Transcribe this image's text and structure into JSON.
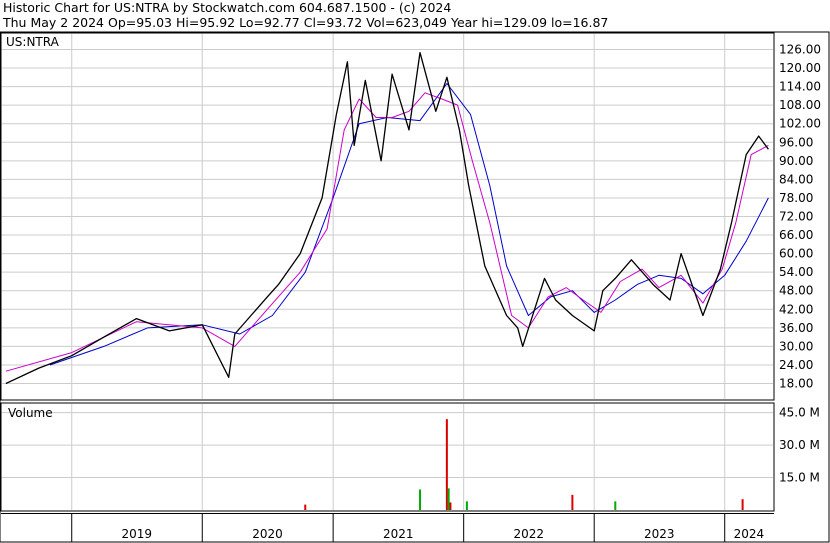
{
  "header": {
    "line1": "Historic Chart for US:NTRA by Stockwatch.com 604.687.1500 - (c) 2024",
    "line2": "Thu May  2 2024   Op=95.03   Hi=95.92   Lo=92.77   Cl=93.72   Vol=623,049   Year hi=129.09   lo=16.87"
  },
  "colors": {
    "price": "#000000",
    "ma_short": "#cc00cc",
    "ma_long": "#0000cc",
    "volume_down": "#dd0000",
    "volume_up": "#00aa00",
    "grid": "#cccccc"
  },
  "chart_data": [
    {
      "type": "line",
      "title": "US:NTRA",
      "series": [
        {
          "name": "",
          "role": "price",
          "color": "#000000",
          "x": [
            "2018-07-01",
            "2018-10-01",
            "2019-01-01",
            "2019-04-01",
            "2019-07-01",
            "2019-10-01",
            "2020-01-01",
            "2020-03-15",
            "2020-04-01",
            "2020-07-01",
            "2020-08-01",
            "2020-10-01",
            "2020-12-01",
            "2021-01-10",
            "2021-02-10",
            "2021-03-01",
            "2021-04-01",
            "2021-05-15",
            "2021-06-15",
            "2021-08-01",
            "2021-09-01",
            "2021-10-15",
            "2021-11-15",
            "2021-12-20",
            "2022-01-15",
            "2022-02-15",
            "2022-03-01",
            "2022-05-01",
            "2022-06-01",
            "2022-06-15",
            "2022-08-15",
            "2022-09-15",
            "2022-11-01",
            "2023-01-01",
            "2023-01-25",
            "2023-03-01",
            "2023-04-15",
            "2023-06-15",
            "2023-08-01",
            "2023-09-01",
            "2023-11-01",
            "2023-12-20",
            "2024-01-20",
            "2024-03-01",
            "2024-04-05",
            "2024-05-02"
          ],
          "values": [
            18,
            23,
            27,
            33,
            39,
            35,
            37,
            20,
            34,
            46,
            50,
            60,
            78,
            105,
            122,
            95,
            116,
            90,
            118,
            100,
            125,
            106,
            117,
            100,
            82,
            64,
            56,
            40,
            36,
            30,
            52,
            45,
            40,
            35,
            48,
            52,
            58,
            50,
            45,
            60,
            40,
            55,
            70,
            92,
            98,
            93.72
          ]
        },
        {
          "name": "",
          "role": "moving-average-short",
          "color": "#cc00cc",
          "x": [
            "2018-07-01",
            "2019-01-01",
            "2019-07-01",
            "2020-01-01",
            "2020-04-01",
            "2020-07-01",
            "2020-10-01",
            "2020-12-15",
            "2021-02-01",
            "2021-03-15",
            "2021-05-01",
            "2021-06-15",
            "2021-08-01",
            "2021-09-15",
            "2021-11-01",
            "2021-12-15",
            "2022-01-25",
            "2022-03-15",
            "2022-05-15",
            "2022-07-01",
            "2022-08-25",
            "2022-10-15",
            "2022-12-01",
            "2023-01-20",
            "2023-03-15",
            "2023-05-15",
            "2023-07-01",
            "2023-09-01",
            "2023-11-01",
            "2023-12-25",
            "2024-02-01",
            "2024-03-15",
            "2024-05-02"
          ],
          "values": [
            22,
            28,
            38,
            36,
            30,
            42,
            54,
            68,
            100,
            110,
            104,
            104,
            106,
            112,
            110,
            108,
            90,
            70,
            40,
            36,
            46,
            49,
            45,
            41,
            51,
            55,
            49,
            53,
            44,
            55,
            70,
            92,
            95
          ]
        },
        {
          "name": "",
          "role": "moving-average-long",
          "color": "#0000cc",
          "x": [
            "2018-11-01",
            "2019-04-01",
            "2019-08-01",
            "2020-01-01",
            "2020-04-15",
            "2020-07-15",
            "2020-10-15",
            "2021-01-01",
            "2021-03-15",
            "2021-06-01",
            "2021-09-01",
            "2021-11-15",
            "2022-01-20",
            "2022-03-15",
            "2022-05-01",
            "2022-07-01",
            "2022-09-01",
            "2022-11-01",
            "2023-01-01",
            "2023-03-01",
            "2023-05-01",
            "2023-07-01",
            "2023-09-01",
            "2023-11-01",
            "2024-01-01",
            "2024-03-01",
            "2024-05-02"
          ],
          "values": [
            24,
            30,
            36,
            37,
            34,
            40,
            54,
            78,
            102,
            104,
            103,
            115,
            105,
            82,
            56,
            40,
            46,
            48,
            41,
            45,
            50,
            53,
            52,
            47,
            53,
            64,
            78
          ]
        }
      ],
      "y_ticks": [
        "126.00",
        "120.00",
        "114.00",
        "108.00",
        "102.00",
        "96.00",
        "90.00",
        "84.00",
        "78.00",
        "72.00",
        "66.00",
        "60.00",
        "54.00",
        "48.00",
        "42.00",
        "36.00",
        "30.00",
        "24.00",
        "18.00"
      ],
      "ylim": [
        13,
        131
      ],
      "grid": true,
      "legend": "none"
    },
    {
      "type": "bar",
      "title": "Volume",
      "y_ticks": [
        "45.0 M",
        "30.0 M",
        "15.0 M"
      ],
      "ylim": [
        0,
        49
      ],
      "x": [
        "2020-10-15",
        "2021-09-01",
        "2021-11-15",
        "2021-11-20",
        "2021-11-25",
        "2022-01-10",
        "2022-11-01",
        "2023-03-01",
        "2024-02-20"
      ],
      "values": [
        2.5,
        9.5,
        42,
        10,
        3.5,
        4,
        7,
        4,
        5
      ],
      "grid": true
    }
  ],
  "x_axis": {
    "range": [
      "2018-06-20",
      "2024-05-15"
    ],
    "year_labels": [
      {
        "label": "2019",
        "start": "2019-01-01",
        "end": "2019-12-31"
      },
      {
        "label": "2020",
        "start": "2020-01-01",
        "end": "2020-12-31"
      },
      {
        "label": "2021",
        "start": "2021-01-01",
        "end": "2021-12-31"
      },
      {
        "label": "2022",
        "start": "2022-01-01",
        "end": "2022-12-31"
      },
      {
        "label": "2023",
        "start": "2023-01-01",
        "end": "2023-12-31"
      },
      {
        "label": "2024",
        "start": "2024-01-01",
        "end": "2024-05-15"
      }
    ]
  }
}
